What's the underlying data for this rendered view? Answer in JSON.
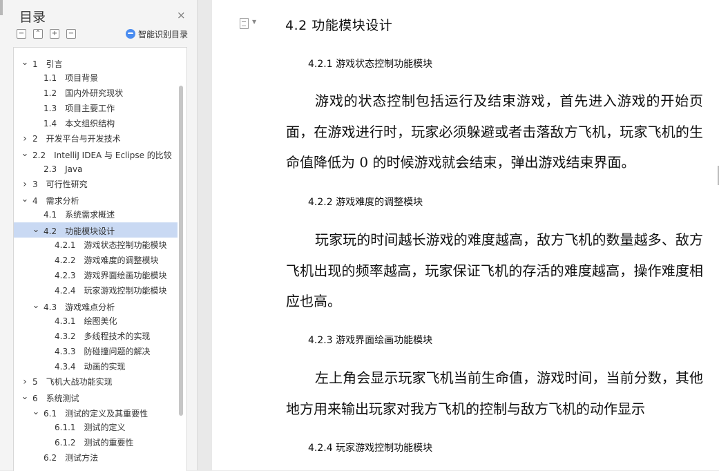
{
  "sidebar": {
    "title": "目录",
    "close_icon": "×",
    "tools": {
      "collapse": "−",
      "expand": "⌃",
      "add": "+",
      "remove": "−"
    },
    "smart_label": "智能识别目录",
    "colors": {
      "selected": "#c9d9f3",
      "ai_accent": "#4a8cf0"
    }
  },
  "toc": [
    {
      "num": "1",
      "label": "引言",
      "level": 1,
      "expanded": true
    },
    {
      "num": "1.1",
      "label": "项目背景",
      "level": 2
    },
    {
      "num": "1.2",
      "label": "国内外研究现状",
      "level": 2
    },
    {
      "num": "1.3",
      "label": "项目主要工作",
      "level": 2
    },
    {
      "num": "1.4",
      "label": "本文组织结构",
      "level": 2
    },
    {
      "num": "2",
      "label": "开发平台与开发技术",
      "level": 1,
      "expanded": false
    },
    {
      "num": "2.2",
      "label": "IntelliJ IDEA 与 Eclipse  的比较",
      "level": 1,
      "expanded": true
    },
    {
      "num": "2.3",
      "label": "Java",
      "level": 2
    },
    {
      "num": "3",
      "label": "可行性研究",
      "level": 1,
      "expanded": false
    },
    {
      "num": "4",
      "label": "需求分析",
      "level": 1,
      "expanded": true
    },
    {
      "num": "4.1",
      "label": "系统需求概述",
      "level": 2
    },
    {
      "num": "4.2",
      "label": "功能模块设计",
      "level": 2,
      "expanded": true,
      "selected": true
    },
    {
      "num": "4.2.1",
      "label": "游戏状态控制功能模块",
      "level": 3
    },
    {
      "num": "4.2.2",
      "label": "游戏难度的调整模块",
      "level": 3
    },
    {
      "num": "4.2.3",
      "label": "游戏界面绘画功能模块",
      "level": 3
    },
    {
      "num": "4.2.4",
      "label": "玩家游戏控制功能模块",
      "level": 3
    },
    {
      "num": "4.3",
      "label": "游戏难点分析",
      "level": 2,
      "expanded": true
    },
    {
      "num": "4.3.1",
      "label": "绘图美化",
      "level": 3
    },
    {
      "num": "4.3.2",
      "label": "多线程技术的实现",
      "level": 3
    },
    {
      "num": "4.3.3",
      "label": "防碰撞问题的解决",
      "level": 3
    },
    {
      "num": "4.3.4",
      "label": "动画的实现",
      "level": 3
    },
    {
      "num": "5",
      "label": "飞机大战功能实现",
      "level": 1,
      "expanded": false
    },
    {
      "num": "6",
      "label": "系统测试",
      "level": 1,
      "expanded": true
    },
    {
      "num": "6.1",
      "label": "测试的定义及其重要性",
      "level": 2,
      "expanded": true
    },
    {
      "num": "6.1.1",
      "label": "测试的定义",
      "level": 3
    },
    {
      "num": "6.1.2",
      "label": "测试的重要性",
      "level": 3
    },
    {
      "num": "6.2",
      "label": "测试方法",
      "level": 2
    }
  ],
  "doc": {
    "h2": "4.2   功能模块设计",
    "s1_title": "4.2.1   游戏状态控制功能模块",
    "s1_text": "游戏的状态控制包括运行及结束游戏，首先进入游戏的开始页面，在游戏进行时，玩家必须躲避或者击落敌方飞机，玩家飞机的生命值降低为 0 的时候游戏就会结束，弹出游戏结束界面。",
    "s2_title": "4.2.2   游戏难度的调整模块",
    "s2_text": "玩家玩的时间越长游戏的难度越高，敌方飞机的数量越多、敌方飞机出现的频率越高，玩家保证飞机的存活的难度越高，操作难度相应也高。",
    "s3_title": "4.2.3   游戏界面绘画功能模块",
    "s3_text": "左上角会显示玩家飞机当前生命值，游戏时间，当前分数，其他地方用来输出玩家对我方飞机的控制与敌方飞机的动作显示",
    "s4_title": "4.2.4   玩家游戏控制功能模块"
  }
}
